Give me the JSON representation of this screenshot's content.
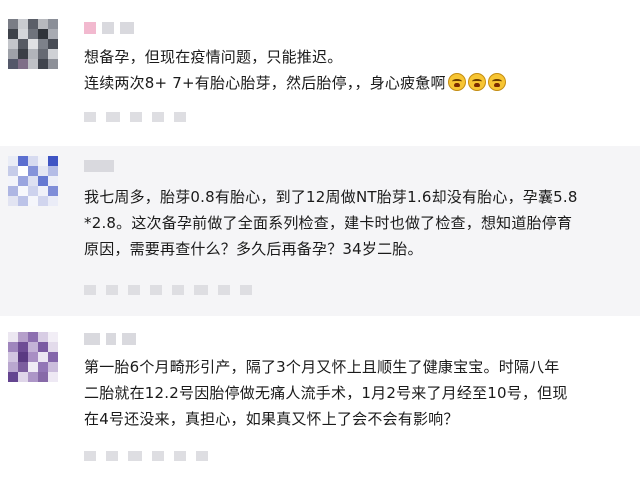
{
  "comments": [
    {
      "lines": [
        "想备孕，但现在疫情问题，只能推迟。",
        "连续两次8+ 7+有胎心胎芽，然后胎停，，身心疲惫啊"
      ],
      "emoji": [
        "crying-face-icon",
        "crying-face-icon",
        "crying-face-icon"
      ]
    },
    {
      "lines": [
        "我七周多，胎芽0.8有胎心，到了12周做NT胎芽1.6却没有胎心，孕囊5.8",
        "*2.8。这次备孕前做了全面系列检查，建卡时也做了检查，想知道胎停育",
        "原因，需要再查什么？多久后再备孕？34岁二胎。"
      ]
    },
    {
      "lines": [
        "第一胎6个月畸形引产，隔了3个月又怀上且顺生了健康宝宝。时隔八年",
        "二胎就在12.2号因胎停做无痛人流手术，1月2号来了月经至10号，但现",
        "在4号还没来，真担心，如果真又怀上了会不会有影响？"
      ]
    }
  ],
  "colors": {
    "background": "#ffffff",
    "alt_background": "#f5f5f7",
    "text": "#1a1a1a",
    "blur_placeholder": "#d9d9de"
  }
}
